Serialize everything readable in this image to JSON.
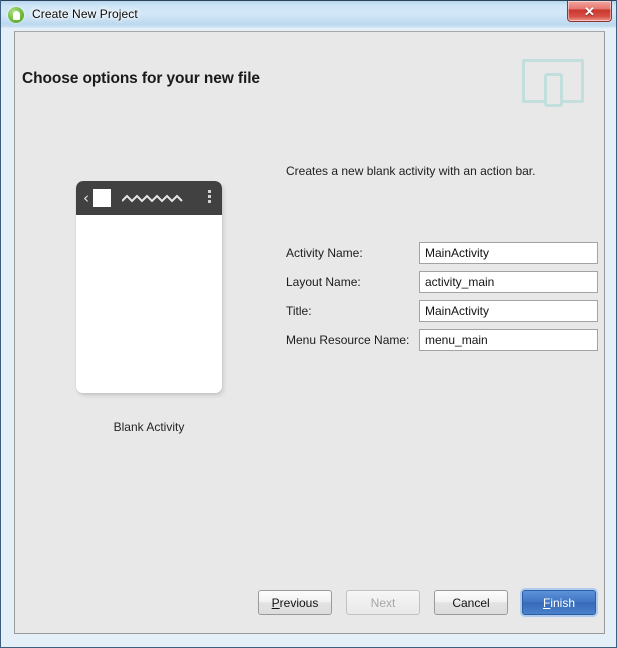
{
  "window": {
    "title": "Create New Project",
    "app_icon": "android-icon",
    "close_label": "✕"
  },
  "header": {
    "title": "Choose options for your new file",
    "icon": "tablet-phone-icon",
    "icon_color": "#c2dedd"
  },
  "preview": {
    "caption": "Blank Activity",
    "action_bar": {
      "back_icon": "‹",
      "app_icon": "app-square-icon",
      "title_placeholder": "squiggle-line",
      "overflow_icon": "overflow-menu-icon"
    }
  },
  "main": {
    "description": "Creates a new blank activity with an action bar.",
    "fields": [
      {
        "label": "Activity Name:",
        "value": "MainActivity",
        "name": "activity-name"
      },
      {
        "label": "Layout Name:",
        "value": "activity_main",
        "name": "layout-name"
      },
      {
        "label": "Title:",
        "value": "MainActivity",
        "name": "title"
      },
      {
        "label": "Menu Resource Name:",
        "value": "menu_main",
        "name": "menu-resource-name"
      }
    ]
  },
  "footer": {
    "previous": {
      "pre": "P",
      "post": "revious",
      "enabled": true
    },
    "next": {
      "label": "Next",
      "enabled": false
    },
    "cancel": {
      "label": "Cancel",
      "enabled": true
    },
    "finish": {
      "pre": "F",
      "post": "inish",
      "enabled": true,
      "primary": true
    }
  },
  "colors": {
    "panel_bg": "#e8e8e8",
    "accent_blue": "#4076c4",
    "action_bar": "#414141",
    "titlebar_blue": "#cfe6f7"
  }
}
